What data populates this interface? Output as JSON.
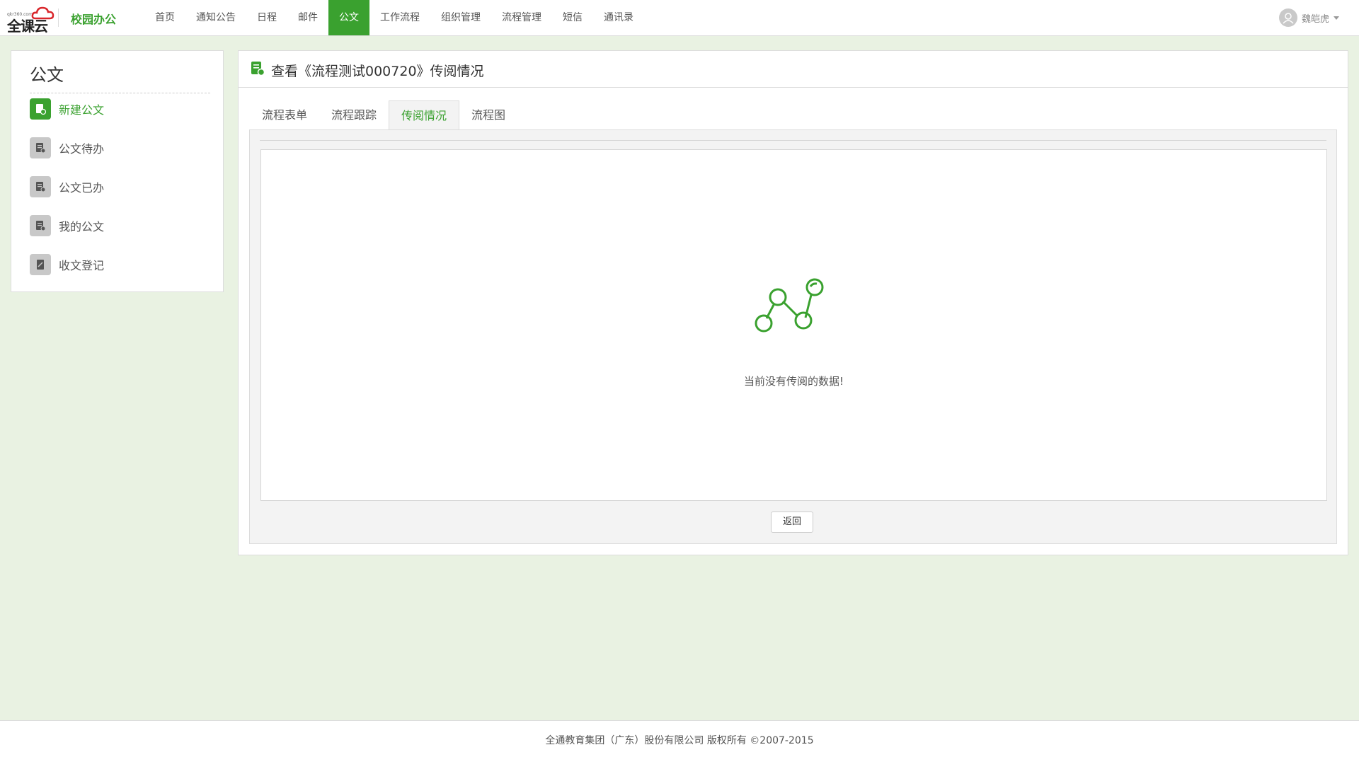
{
  "header": {
    "logo_text": "全课云",
    "logo_url_text": "qkr360.com",
    "app_title": "校园办公",
    "nav": [
      {
        "label": "首页"
      },
      {
        "label": "通知公告"
      },
      {
        "label": "日程"
      },
      {
        "label": "邮件"
      },
      {
        "label": "公文",
        "active": true
      },
      {
        "label": "工作流程"
      },
      {
        "label": "组织管理"
      },
      {
        "label": "流程管理"
      },
      {
        "label": "短信"
      },
      {
        "label": "通讯录"
      }
    ],
    "user_name": "魏皑虎"
  },
  "sidebar": {
    "title": "公文",
    "items": [
      {
        "label": "新建公文",
        "icon": "new-doc-icon",
        "active": true
      },
      {
        "label": "公文待办",
        "icon": "doc-icon"
      },
      {
        "label": "公文已办",
        "icon": "doc-icon"
      },
      {
        "label": "我的公文",
        "icon": "doc-icon"
      },
      {
        "label": "收文登记",
        "icon": "register-icon"
      }
    ]
  },
  "main": {
    "title": "查看《流程测试000720》传阅情况",
    "tabs": [
      {
        "label": "流程表单"
      },
      {
        "label": "流程跟踪"
      },
      {
        "label": "传阅情况",
        "active": true
      },
      {
        "label": "流程图"
      }
    ],
    "empty_message": "当前没有传阅的数据!",
    "back_label": "返回"
  },
  "footer": {
    "copyright": "全通教育集团（广东）股份有限公司 版权所有 ©2007-2015"
  },
  "colors": {
    "accent": "#3aa12f",
    "background": "#e9f2e2"
  }
}
